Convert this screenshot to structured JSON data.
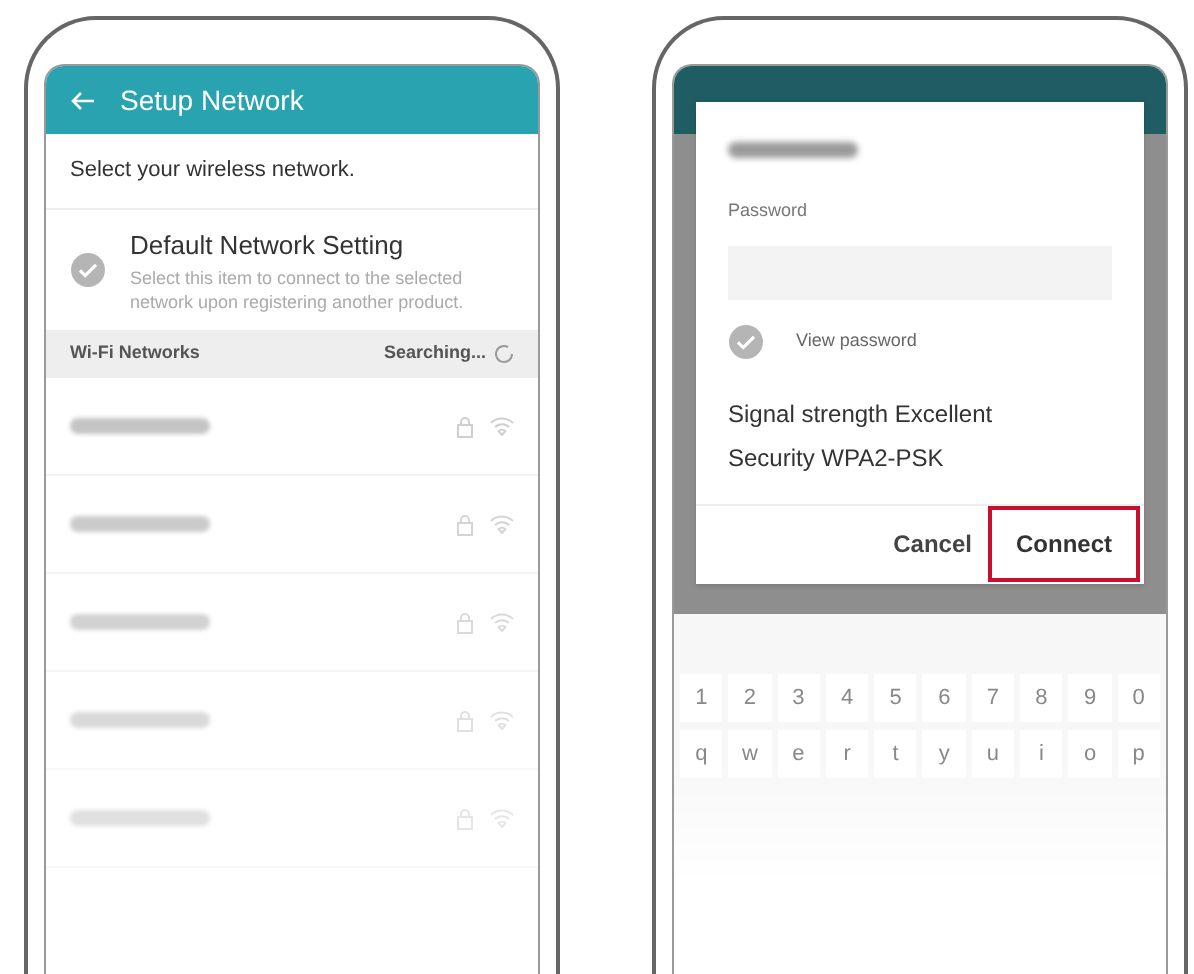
{
  "phones": [
    {
      "kind": "network_list",
      "header": {
        "title": "Setup Network"
      },
      "prompt": "Select your wireless network.",
      "default_setting": {
        "title": "Default Network Setting",
        "description": "Select this item to connect to the selected network upon registering another product.",
        "checked": false
      },
      "section": {
        "title": "Wi-Fi Networks",
        "status": "Searching..."
      },
      "networks": [
        {
          "secured": true
        },
        {
          "secured": true
        },
        {
          "secured": true
        },
        {
          "secured": true
        },
        {
          "secured": true
        }
      ]
    },
    {
      "kind": "password_dialog",
      "dialog": {
        "password_label": "Password",
        "view_password": {
          "label": "View password",
          "checked": false
        },
        "signal": "Signal strength Excellent",
        "security": "Security WPA2-PSK",
        "buttons": [
          {
            "label": "Cancel",
            "highlighted": false
          },
          {
            "label": "Connect",
            "highlighted": true
          }
        ]
      },
      "keyboard": [
        [
          "1",
          "2",
          "3",
          "4",
          "5",
          "6",
          "7",
          "8",
          "9",
          "0"
        ],
        [
          "q",
          "w",
          "e",
          "r",
          "t",
          "y",
          "u",
          "i",
          "o",
          "p"
        ]
      ]
    }
  ]
}
